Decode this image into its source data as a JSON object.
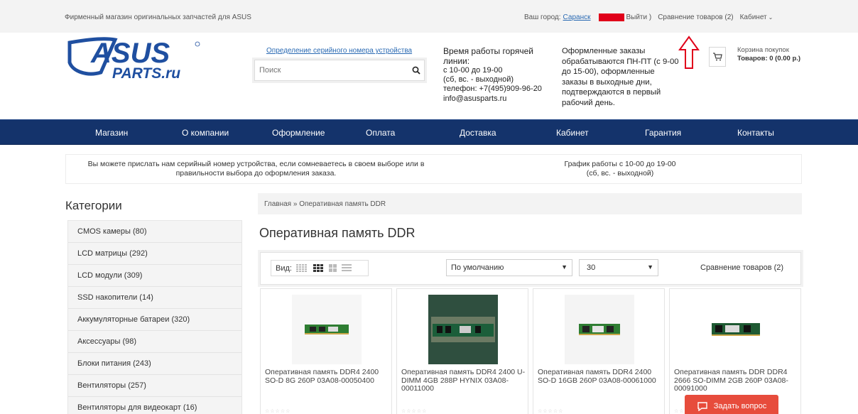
{
  "topbar": {
    "tagline": "Фирменный магазин оригинальных запчастей для ASUS",
    "city_label": "Ваш город:",
    "city": "Саранск",
    "logout": "Выйти )",
    "compare": "Сравнение товаров (2)",
    "cabinet": "Кабинет"
  },
  "header": {
    "serial_link": "Определение серийного номера устройства",
    "search_placeholder": "Поиск",
    "hotline_title": "Время работы горячей линии:",
    "hotline_lines": [
      "с 10-00 до 19-00",
      "(сб, вс. - выходной)",
      "телефон: +7(495)909-96-20",
      "info@asusparts.ru"
    ],
    "orders_text": "Оформленные заказы обрабатываются ПН-ПТ (с 9-00 до 15-00), оформленные заказы в выходные дни, подтверждаются в первый рабочий день.",
    "cart_title": "Корзина покупок",
    "cart_value": "Товаров: 0 (0.00 р.)",
    "logo_text_top": "ASUS",
    "logo_text_bottom": "PARTS.ru"
  },
  "nav": [
    "Магазин",
    "О компании",
    "Оформление",
    "Оплата",
    "Доставка",
    "Кабинет",
    "Гарантия",
    "Контакты"
  ],
  "notice": {
    "left": "Вы можете прислать нам серийный номер устройства, если сомневаетесь в своем выборе или в правильности выбора до оформления заказа.",
    "right_1": "График работы с 10-00 до 19-00",
    "right_2": "(сб, вс. - выходной)"
  },
  "sidebar": {
    "title": "Категории",
    "items": [
      "CMOS камеры (80)",
      "LCD матрицы (292)",
      "LCD модули (309)",
      "SSD накопители (14)",
      "Аккумуляторные батареи (320)",
      "Аксессуары (98)",
      "Блоки питания (243)",
      "Вентиляторы (257)",
      "Вентиляторы для видеокарт (16)"
    ]
  },
  "main": {
    "breadcrumb_home": "Главная",
    "breadcrumb_sep": " » ",
    "breadcrumb_current": "Оперативная память DDR",
    "title": "Оперативная память DDR",
    "view_label": "Вид:",
    "sort_value": "По умолчанию",
    "per_page_value": "30",
    "compare_link": "Сравнение товаров (2)",
    "products": [
      {
        "name": "Оперативная память DDR4 2400 SO-D 8G 260P 03A08-00050400"
      },
      {
        "name": "Оперативная память DDR4 2400 U-DIMM 4GB 288P HYNIX 03A08-00011000"
      },
      {
        "name": "Оперативная память DDR4 2400 SO-D 16GB 260P 03A08-00061000"
      },
      {
        "name": "Оперативная память DDR DDR4 2666 SO-DIMM 2GB 260P 03A08-00091000"
      }
    ],
    "stars": "☆☆☆☆☆"
  },
  "ask_button": "Задать вопрос",
  "colors": {
    "nav_bg": "#14336b",
    "logo_blue": "#1f4fa0",
    "link": "#2a6ab3",
    "ask_bg": "#e74c3c",
    "annotation_arrow": "#e0001a"
  }
}
